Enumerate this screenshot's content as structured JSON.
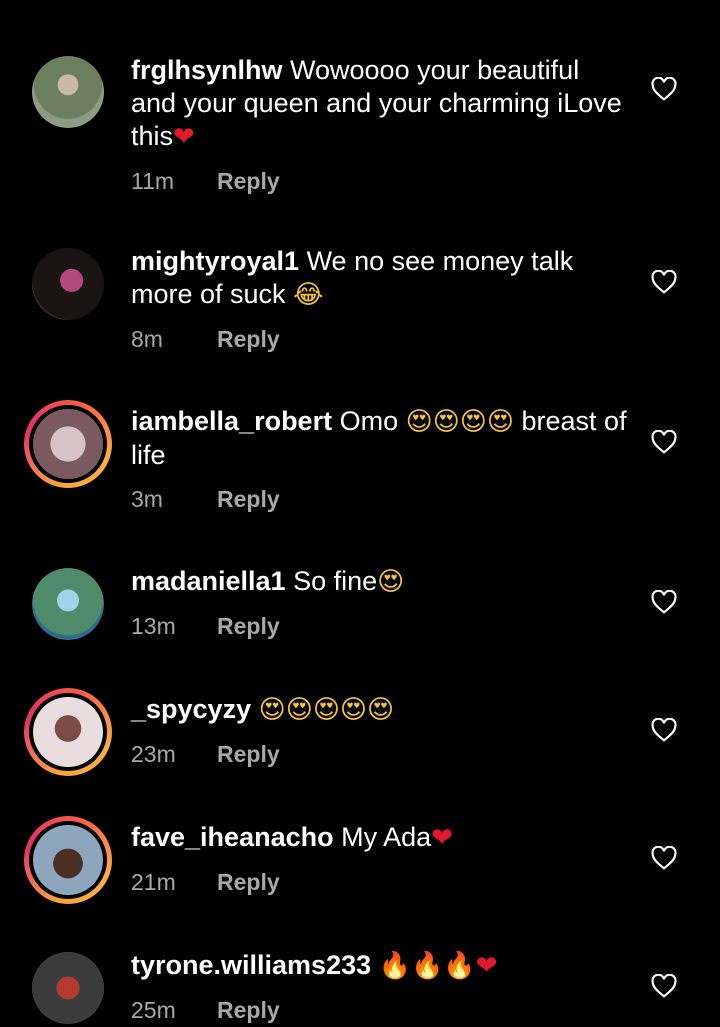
{
  "comments": [
    {
      "username": "frglhsynlhw",
      "text": " Wowoooo your beautiful and your queen and your charming iLove this",
      "emoji": "❤",
      "emoji_kind": "red",
      "time": "11m",
      "reply": "Reply",
      "avatar_ring": false,
      "avatar_colors": [
        "#6b7f5e",
        "#c9b9a5"
      ]
    },
    {
      "username": "mightyroyal1",
      "text": " We no see money talk more of suck ",
      "emoji": "😂",
      "emoji_kind": "eyes",
      "time": "8m",
      "reply": "Reply",
      "avatar_ring": false,
      "avatar_colors": [
        "#1b1414",
        "#b44a7a"
      ]
    },
    {
      "username": "iambella_robert",
      "text": " Omo ",
      "emoji": "😍😍😍😍",
      "emoji_kind": "eyes",
      "text_after": " breast of life",
      "time": "3m",
      "reply": "Reply",
      "avatar_ring": true,
      "avatar_colors": [
        "#d8c3c8",
        "#7a5a5e"
      ]
    },
    {
      "username": "madaniella1",
      "text": " So fine",
      "emoji": "😍",
      "emoji_kind": "eyes",
      "time": "13m",
      "reply": "Reply",
      "avatar_ring": false,
      "avatar_colors": [
        "#4f8a6b",
        "#9fd3e8"
      ]
    },
    {
      "username": "_spycyzy",
      "text": " ",
      "emoji": "😍😍😍😍😍",
      "emoji_kind": "eyes",
      "time": "23m",
      "reply": "Reply",
      "avatar_ring": true,
      "avatar_colors": [
        "#e9dde0",
        "#7b4b45"
      ]
    },
    {
      "username": "fave_iheanacho",
      "text": " My Ada",
      "emoji": "❤",
      "emoji_kind": "red",
      "time": "21m",
      "reply": "Reply",
      "avatar_ring": true,
      "avatar_colors": [
        "#8ea6bd",
        "#4a3024"
      ]
    },
    {
      "username": "tyrone.williams233",
      "text": " ",
      "emoji": "🔥🔥🔥",
      "emoji_kind": "fire",
      "emoji2": "❤",
      "time": "25m",
      "reply": "Reply",
      "avatar_ring": false,
      "avatar_colors": [
        "#3b3b3b",
        "#b33a2c"
      ]
    }
  ],
  "like_icon": "heart-outline-icon"
}
